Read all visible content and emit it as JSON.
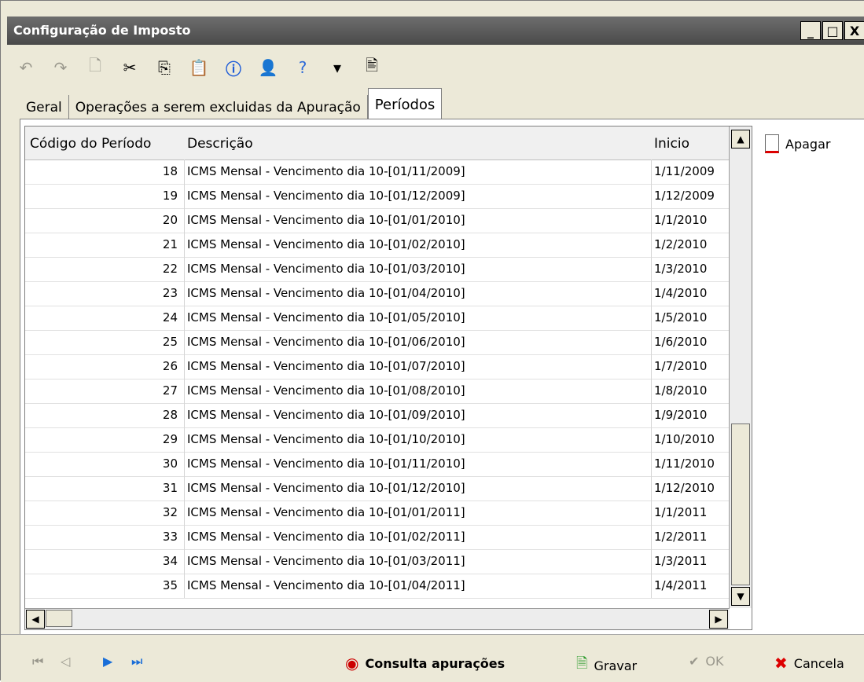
{
  "window": {
    "title": "Configuração de Imposto",
    "buttons": [
      "_",
      "□",
      "X"
    ]
  },
  "toolbar": {
    "icons": [
      "undo-icon",
      "redo-icon",
      "new-doc-icon",
      "cut-icon",
      "copy-icon",
      "paste-icon",
      "info-icon",
      "user-icon",
      "help-icon",
      "dropdown-icon",
      "document-icon"
    ]
  },
  "tabs": [
    {
      "label": "Geral"
    },
    {
      "label": "Operações a serem excluidas da Apuração"
    },
    {
      "label": "Períodos"
    }
  ],
  "grid": {
    "headers": [
      "Código do Período",
      "Descrição",
      "Inicio"
    ],
    "rows": [
      {
        "code": "18",
        "desc": "ICMS Mensal - Vencimento dia 10-[01/11/2009]",
        "start": "1/11/2009"
      },
      {
        "code": "19",
        "desc": "ICMS Mensal - Vencimento dia 10-[01/12/2009]",
        "start": "1/12/2009"
      },
      {
        "code": "20",
        "desc": "ICMS Mensal - Vencimento dia 10-[01/01/2010]",
        "start": "1/1/2010"
      },
      {
        "code": "21",
        "desc": "ICMS Mensal - Vencimento dia 10-[01/02/2010]",
        "start": "1/2/2010"
      },
      {
        "code": "22",
        "desc": "ICMS Mensal - Vencimento dia 10-[01/03/2010]",
        "start": "1/3/2010"
      },
      {
        "code": "23",
        "desc": "ICMS Mensal - Vencimento dia 10-[01/04/2010]",
        "start": "1/4/2010"
      },
      {
        "code": "24",
        "desc": "ICMS Mensal - Vencimento dia 10-[01/05/2010]",
        "start": "1/5/2010"
      },
      {
        "code": "25",
        "desc": "ICMS Mensal - Vencimento dia 10-[01/06/2010]",
        "start": "1/6/2010"
      },
      {
        "code": "26",
        "desc": "ICMS Mensal - Vencimento dia 10-[01/07/2010]",
        "start": "1/7/2010"
      },
      {
        "code": "27",
        "desc": "ICMS Mensal - Vencimento dia 10-[01/08/2010]",
        "start": "1/8/2010"
      },
      {
        "code": "28",
        "desc": "ICMS Mensal - Vencimento dia 10-[01/09/2010]",
        "start": "1/9/2010"
      },
      {
        "code": "29",
        "desc": "ICMS Mensal - Vencimento dia 10-[01/10/2010]",
        "start": "1/10/2010"
      },
      {
        "code": "30",
        "desc": "ICMS Mensal - Vencimento dia 10-[01/11/2010]",
        "start": "1/11/2010"
      },
      {
        "code": "31",
        "desc": "ICMS Mensal - Vencimento dia 10-[01/12/2010]",
        "start": "1/12/2010"
      },
      {
        "code": "32",
        "desc": "ICMS Mensal - Vencimento dia 10-[01/01/2011]",
        "start": "1/1/2011"
      },
      {
        "code": "33",
        "desc": "ICMS Mensal - Vencimento dia 10-[01/02/2011]",
        "start": "1/2/2011"
      },
      {
        "code": "34",
        "desc": "ICMS Mensal - Vencimento dia 10-[01/03/2011]",
        "start": "1/3/2011"
      },
      {
        "code": "35",
        "desc": "ICMS Mensal - Vencimento dia 10-[01/04/2011]",
        "start": "1/4/2011"
      }
    ]
  },
  "side": {
    "apagar_label": "Apagar"
  },
  "bottom": {
    "consulta_label": "Consulta apurações",
    "gravar_label": "Gravar",
    "ok_label": "OK",
    "cancela_label": "Cancela"
  }
}
